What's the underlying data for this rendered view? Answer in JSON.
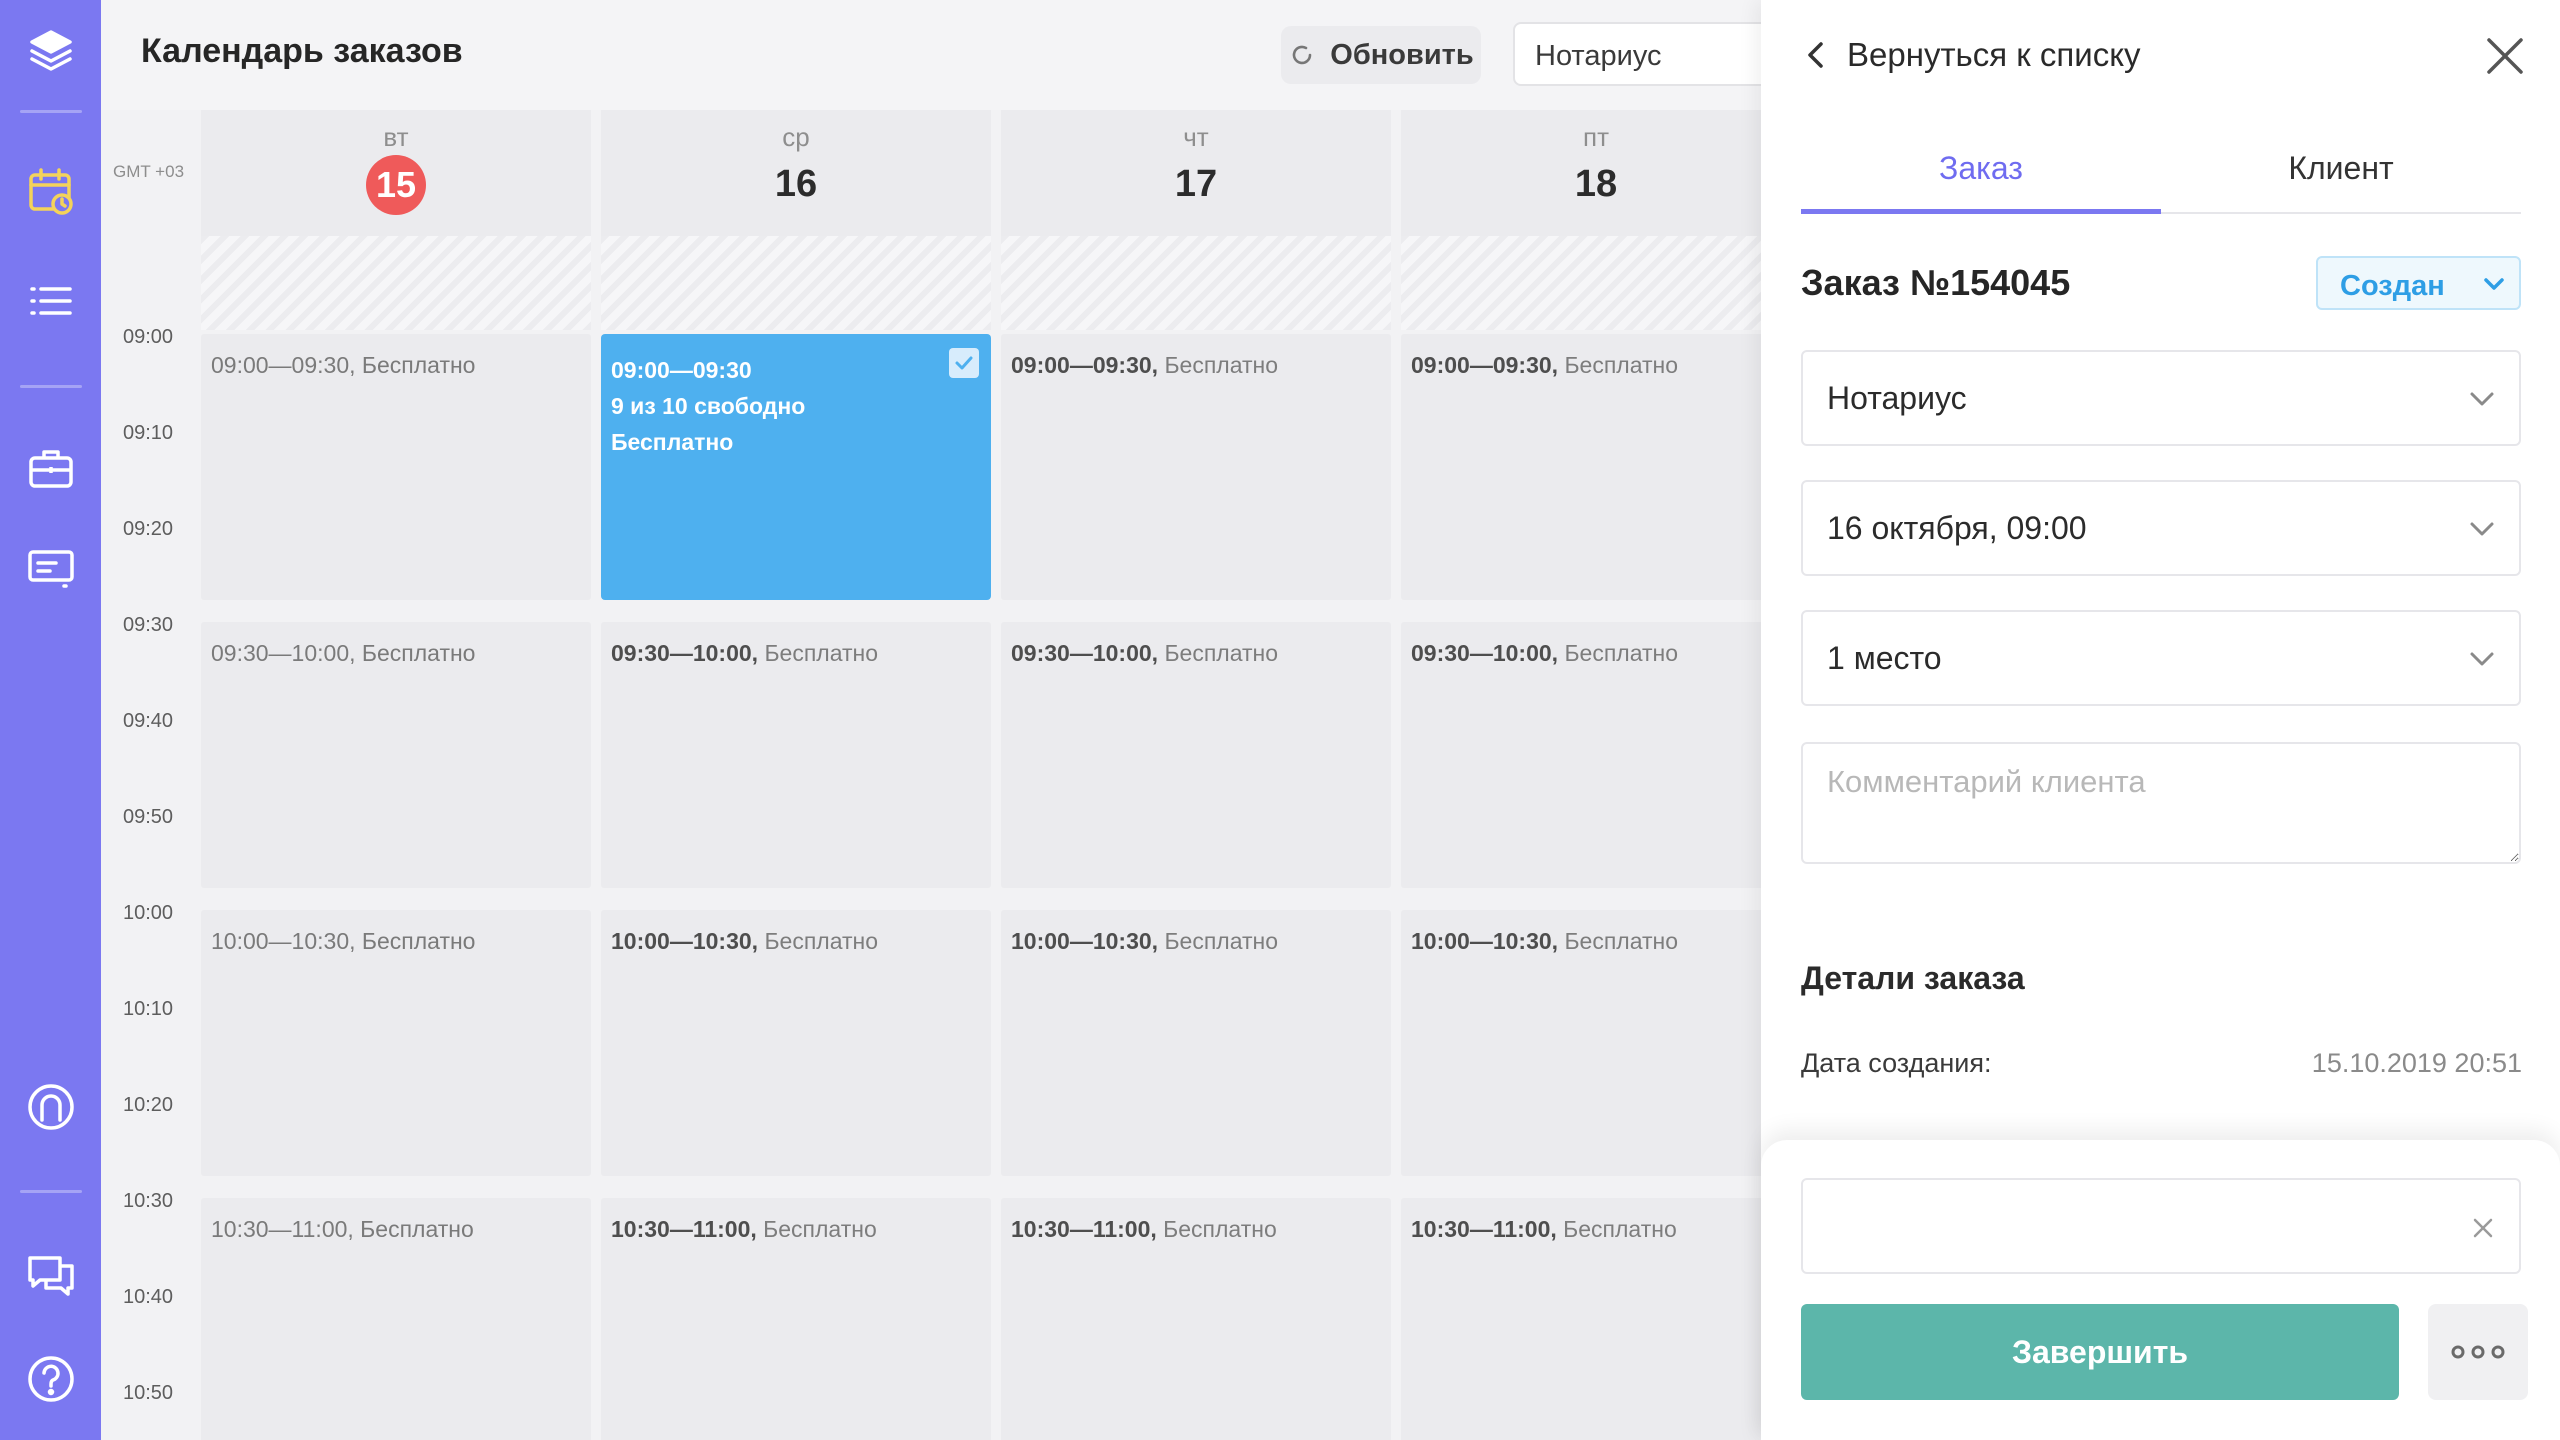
{
  "header": {
    "title": "Календарь заказов",
    "refresh_label": "Обновить",
    "service_value": "Нотариус"
  },
  "calendar": {
    "timezone": "GMT +03",
    "days": [
      {
        "name": "вт",
        "num": "15"
      },
      {
        "name": "ср",
        "num": "16"
      },
      {
        "name": "чт",
        "num": "17"
      },
      {
        "name": "пт",
        "num": "18"
      }
    ],
    "time_labels": [
      "09:00",
      "09:10",
      "09:20",
      "09:30",
      "09:40",
      "09:50",
      "10:00",
      "10:10",
      "10:20",
      "10:30",
      "10:40",
      "10:50"
    ],
    "price": "Бесплатно",
    "slot_times": [
      "09:00—09:30,",
      "09:30—10:00,",
      "10:00—10:30,",
      "10:30—11:00,"
    ],
    "past_slots": [
      "09:00—09:30, Бесплатно",
      "09:30—10:00, Бесплатно",
      "10:00—10:30, Бесплатно",
      "10:30—11:00, Бесплатно"
    ],
    "selected_slot": {
      "time": "09:00—09:30",
      "free": "9 из 10 свободно",
      "price": "Бесплатно"
    }
  },
  "panel": {
    "back_label": "Вернуться к списку",
    "tabs": [
      {
        "label": "Заказ"
      },
      {
        "label": "Клиент"
      }
    ],
    "order_title": "Заказ №154045",
    "status": "Создан",
    "fields": {
      "service": "Нотариус",
      "date": "16 октября, 09:00",
      "places": "1 место"
    },
    "comment_placeholder": "Комментарий клиента",
    "details_title": "Детали заказа",
    "created_label": "Дата создания:",
    "created_value": "15.10.2019 20:51",
    "finish_label": "Завершить"
  },
  "colors": {
    "sidebar": "#7b78f1",
    "today_badge": "#ef5a5a",
    "selected_slot": "#4eb0ef",
    "finish_button": "#5cb6aa",
    "status_text": "#2e9ee5",
    "active_tab": "#6f6cf0"
  }
}
